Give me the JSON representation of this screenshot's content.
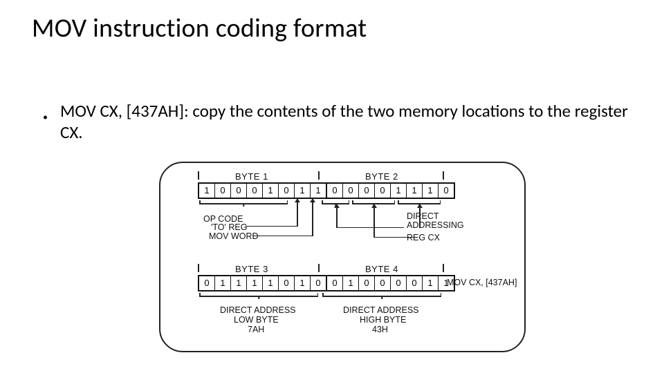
{
  "title": "MOV instruction coding format",
  "bullet": "MOV CX, [437AH]: copy the contents of the two memory locations to the register CX.",
  "diagram": {
    "row1": {
      "byte1_label": "BYTE 1",
      "byte2_label": "BYTE 2",
      "bits": [
        "1",
        "0",
        "0",
        "0",
        "1",
        "0",
        "1",
        "1",
        "0",
        "0",
        "0",
        "0",
        "1",
        "1",
        "1",
        "0"
      ],
      "ann_opcode": "OP CODE",
      "ann_toreg": "'TO' REG",
      "ann_movword": "MOV WORD",
      "ann_direct": "DIRECT",
      "ann_addressing": "ADDRESSING",
      "ann_regcx": "REG CX"
    },
    "row2": {
      "byte3_label": "BYTE 3",
      "byte4_label": "BYTE 4",
      "bits": [
        "0",
        "1",
        "1",
        "1",
        "1",
        "0",
        "1",
        "0",
        "0",
        "1",
        "0",
        "0",
        "0",
        "0",
        "1",
        "1"
      ],
      "side": "MOV CX, [437AH]",
      "ann_low_1": "DIRECT ADDRESS",
      "ann_low_2": "LOW BYTE",
      "ann_low_3": "7AH",
      "ann_high_1": "DIRECT ADDRESS",
      "ann_high_2": "HIGH BYTE",
      "ann_high_3": "43H"
    }
  }
}
